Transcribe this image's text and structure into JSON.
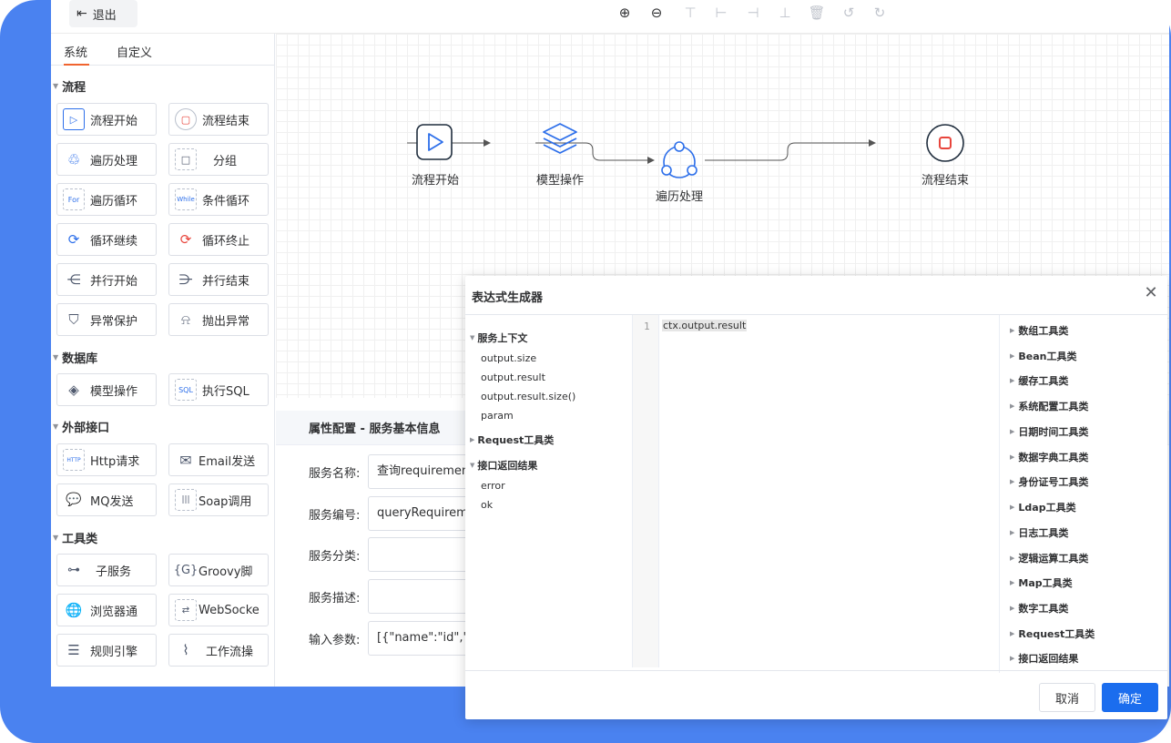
{
  "topbar": {
    "exit_label": "退出",
    "tools": [
      "zoom-in-icon",
      "zoom-out-icon",
      "align-top-icon",
      "align-left-icon",
      "align-right-icon",
      "align-bottom-icon",
      "delete-icon",
      "undo-icon",
      "redo-icon"
    ]
  },
  "sidebar": {
    "tabs": [
      {
        "label": "系统"
      },
      {
        "label": "自定义"
      }
    ],
    "categories": [
      {
        "label": "流程"
      },
      {
        "label": "数据库"
      },
      {
        "label": "外部接口"
      },
      {
        "label": "工具类"
      }
    ],
    "items": [
      {
        "label": "流程开始",
        "icon": "play-icon"
      },
      {
        "label": "流程结束",
        "icon": "stop-icon"
      },
      {
        "label": "遍历处理",
        "icon": "cycle-icon"
      },
      {
        "label": "分组",
        "icon": "group-icon"
      },
      {
        "label": "遍历循环",
        "icon": "for-loop-icon"
      },
      {
        "label": "条件循环",
        "icon": "while-loop-icon"
      },
      {
        "label": "循环继续",
        "icon": "continue-icon"
      },
      {
        "label": "循环终止",
        "icon": "break-icon"
      },
      {
        "label": "并行开始",
        "icon": "fork-icon"
      },
      {
        "label": "并行结束",
        "icon": "join-icon"
      },
      {
        "label": "异常保护",
        "icon": "shield-icon"
      },
      {
        "label": "抛出异常",
        "icon": "alarm-icon"
      },
      {
        "label": "模型操作",
        "icon": "layers-icon"
      },
      {
        "label": "执行SQL",
        "icon": "sql-icon"
      },
      {
        "label": "Http请求",
        "icon": "http-icon"
      },
      {
        "label": "Email发送",
        "icon": "email-icon"
      },
      {
        "label": "MQ发送",
        "icon": "mq-icon"
      },
      {
        "label": "Soap调用",
        "icon": "soap-icon"
      },
      {
        "label": "子服务",
        "icon": "sub-service-icon"
      },
      {
        "label": "Groovy脚",
        "icon": "groovy-icon"
      },
      {
        "label": "浏览器通",
        "icon": "browser-icon"
      },
      {
        "label": "WebSocke",
        "icon": "websocket-icon"
      },
      {
        "label": "规则引擎",
        "icon": "rules-icon"
      },
      {
        "label": "工作流操",
        "icon": "workflow-icon"
      }
    ]
  },
  "canvas": {
    "nodes": [
      {
        "label": "流程开始",
        "icon": "play-icon"
      },
      {
        "label": "模型操作",
        "icon": "layers-icon"
      },
      {
        "label": "遍历处理",
        "icon": "cycle-icon"
      },
      {
        "label": "流程结束",
        "icon": "stop-icon"
      }
    ]
  },
  "properties": {
    "header": "属性配置 - 服务基本信息",
    "fields": [
      {
        "label": "服务名称:",
        "value": "查询requirement"
      },
      {
        "label": "服务编号:",
        "value": "queryRequireme"
      },
      {
        "label": "服务分类:",
        "value": ""
      },
      {
        "label": "服务描述:",
        "value": ""
      },
      {
        "label": "输入参数:",
        "value": "[{\"name\":\"id\",\"ty"
      }
    ]
  },
  "modal": {
    "title": "表达式生成器",
    "context_groups": [
      {
        "label": "服务上下文",
        "expanded": true,
        "items": [
          "output.size",
          "output.result",
          "output.result.size()",
          "param"
        ]
      },
      {
        "label": "Request工具类",
        "expanded": false,
        "items": []
      },
      {
        "label": "接口返回结果",
        "expanded": true,
        "items": [
          "error",
          "ok"
        ]
      }
    ],
    "editor": {
      "line_number": "1",
      "code": "ctx.output.result"
    },
    "tool_categories": [
      "数组工具类",
      "Bean工具类",
      "缓存工具类",
      "系统配置工具类",
      "日期时间工具类",
      "数据字典工具类",
      "身份证号工具类",
      "Ldap工具类",
      "日志工具类",
      "逻辑运算工具类",
      "Map工具类",
      "数字工具类",
      "Request工具类",
      "接口返回结果"
    ],
    "cancel_label": "取消",
    "ok_label": "确定"
  },
  "colors": {
    "accent": "#1b6dee",
    "tab_underline": "#f0642f",
    "frame": "#4a82f0",
    "node_blue": "#2d6fea",
    "node_red": "#e8453c"
  }
}
